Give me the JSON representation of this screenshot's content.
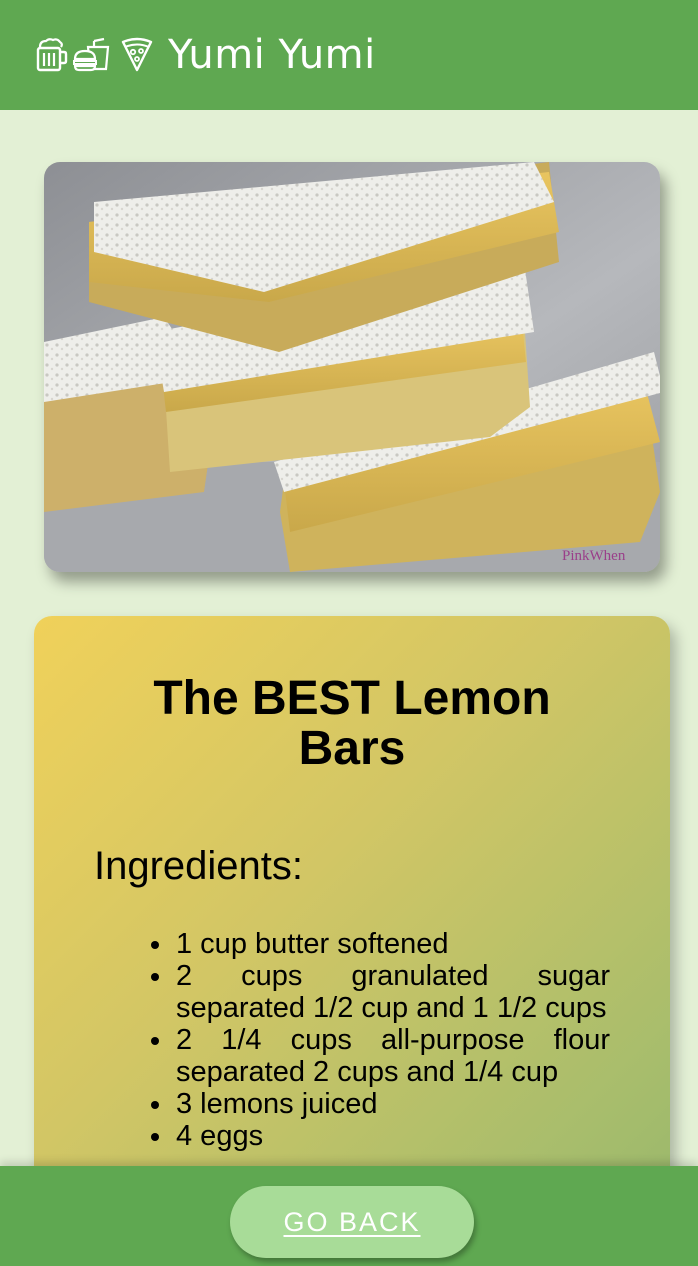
{
  "header": {
    "title": "Yumi Yumi",
    "icons": [
      "beer-mug-icon",
      "burger-drink-icon",
      "pizza-slice-icon"
    ]
  },
  "photo": {
    "watermark": "PinkWhen"
  },
  "recipe": {
    "title": "The BEST Lemon Bars",
    "ingredients_heading": "Ingredients:",
    "ingredients": [
      "1 cup butter softened",
      "2 cups granulated sugar separated 1/2 cup and 1 1/2 cups",
      "2 1/4 cups all-purpose flour separated 2 cups and 1/4 cup",
      "3 lemons juiced",
      "4 eggs"
    ]
  },
  "footer": {
    "back_label": "GO BACK"
  },
  "colors": {
    "header_bg": "#5fa851",
    "page_bg": "#e3f0d5",
    "button_bg": "#a8dc98"
  }
}
